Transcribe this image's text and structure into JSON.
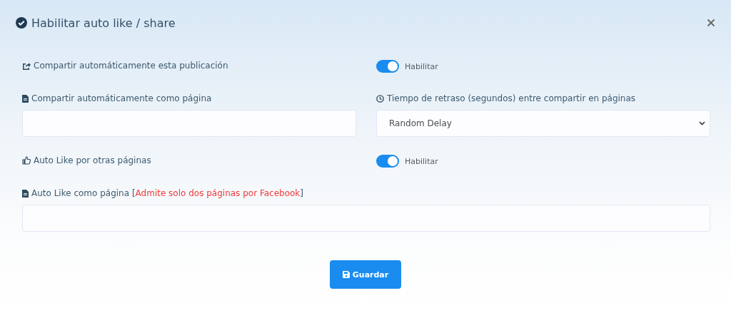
{
  "dialog": {
    "title": "Habilitar auto like / share"
  },
  "rows": [
    {
      "left": {
        "kind": "label",
        "label": "Compartir automáticamente esta publicación"
      },
      "right": {
        "kind": "toggle",
        "on": true,
        "label": "Habilitar"
      }
    },
    {
      "left": {
        "kind": "input",
        "label": "Compartir automáticamente como página"
      },
      "right": {
        "kind": "select",
        "label": "Tiempo de retraso (segundos) entre compartir en páginas",
        "value": "Random Delay"
      }
    },
    {
      "left": {
        "kind": "label",
        "label": "Auto Like por otras páginas"
      },
      "right": {
        "kind": "toggle",
        "on": true,
        "label": "Habilitar"
      }
    },
    {
      "left": {
        "kind": "input",
        "label": "Auto Like como página [",
        "note": "Admite solo dos páginas por Facebook",
        "label_end": "]"
      }
    }
  ],
  "save_button": {
    "label": "Guardar"
  }
}
